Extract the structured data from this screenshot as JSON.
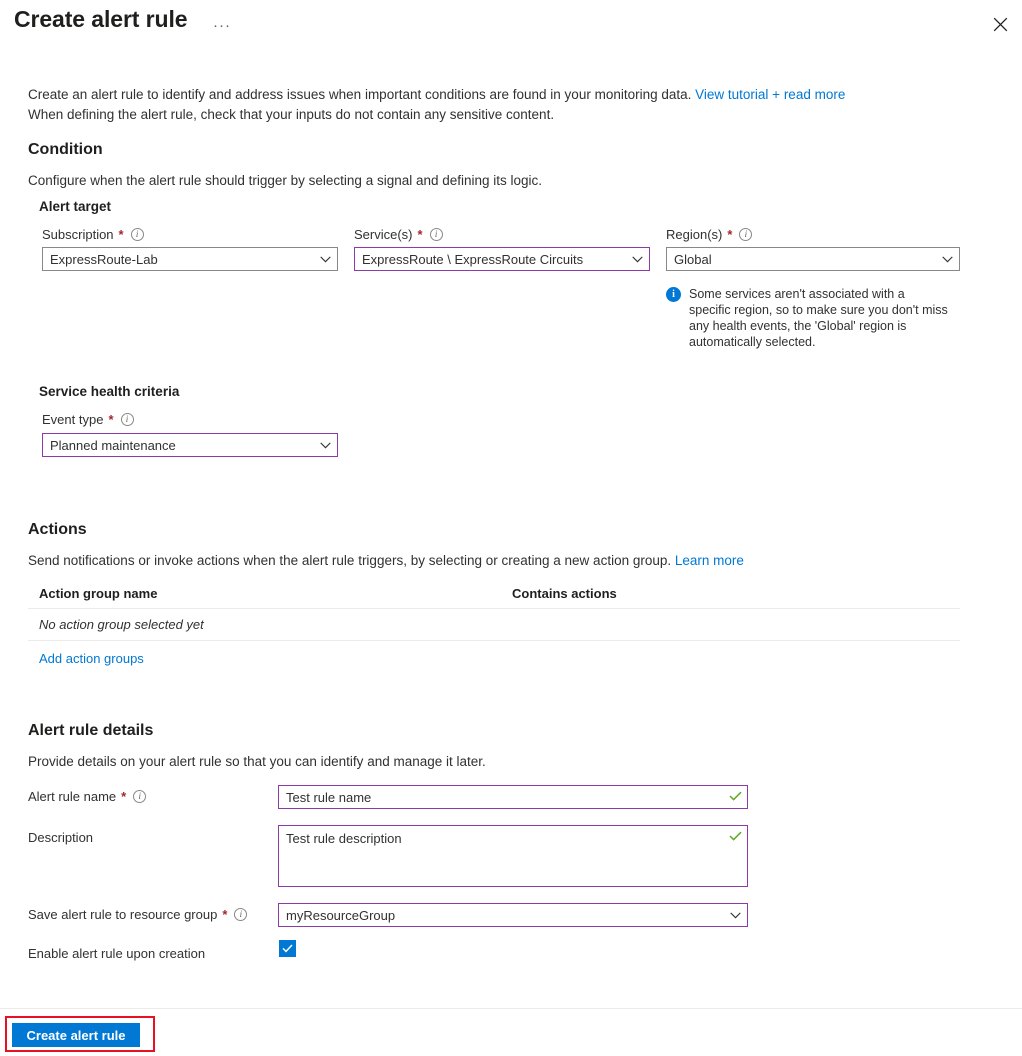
{
  "header": {
    "title": "Create alert rule",
    "more_label": "···",
    "close_label": "",
    "ellipsis_icon": "ellipsis-icon",
    "close_icon": "close-icon"
  },
  "intro": {
    "line1_before": "Create an alert rule to identify and address issues when important conditions are found in your monitoring data. ",
    "line1_link": "View tutorial + read more",
    "line2": "When defining the alert rule, check that your inputs do not contain any sensitive content."
  },
  "condition": {
    "heading": "Condition",
    "subtitle": "Configure when the alert rule should trigger by selecting a signal and defining its logic.",
    "alert_target_heading": "Alert target",
    "subscription": {
      "label": "Subscription",
      "required": "*",
      "value": "ExpressRoute-Lab",
      "border_color": "#8a8886"
    },
    "services": {
      "label": "Service(s)",
      "required": "*",
      "value": "ExpressRoute \\ ExpressRoute Circuits",
      "border_color": "#8e3aa8"
    },
    "regions": {
      "label": "Region(s)",
      "required": "*",
      "value": "Global",
      "border_color": "#8a8886"
    },
    "region_info": {
      "icon": "info-circle-icon",
      "text": "Some services aren't associated with a specific region, so to make sure you don't miss any health events, the 'Global' region is automatically selected.",
      "color": "#0078d4"
    },
    "criteria_heading": "Service health criteria",
    "event_type": {
      "label": "Event type",
      "required": "*",
      "value": "Planned maintenance",
      "border_color": "#8e3aa8"
    }
  },
  "actions": {
    "heading": "Actions",
    "subtitle_before": "Send notifications or invoke actions when the alert rule triggers, by selecting or creating a new action group. ",
    "subtitle_link": "Learn more",
    "columns": [
      "Action group name",
      "Contains actions"
    ],
    "empty_row": "No action group selected yet",
    "add_link": "Add action groups"
  },
  "details": {
    "heading": "Alert rule details",
    "subtitle": "Provide details on your alert rule so that you can identify and manage it later.",
    "rule_name": {
      "label": "Alert rule name",
      "required": "*",
      "value": "Test rule name",
      "valid_icon": "check-icon"
    },
    "description": {
      "label": "Description",
      "value": "Test rule description",
      "valid_icon": "check-icon"
    },
    "resource_group": {
      "label": "Save alert rule to resource group",
      "required": "*",
      "value": "myResourceGroup"
    },
    "enable": {
      "label": "Enable alert rule upon creation",
      "checked": true,
      "check_icon": "checkmark-icon",
      "color": "#0078d4"
    }
  },
  "footer": {
    "create_button": "Create alert rule",
    "highlight_color": "#e81123",
    "button_color": "#0078d4"
  }
}
